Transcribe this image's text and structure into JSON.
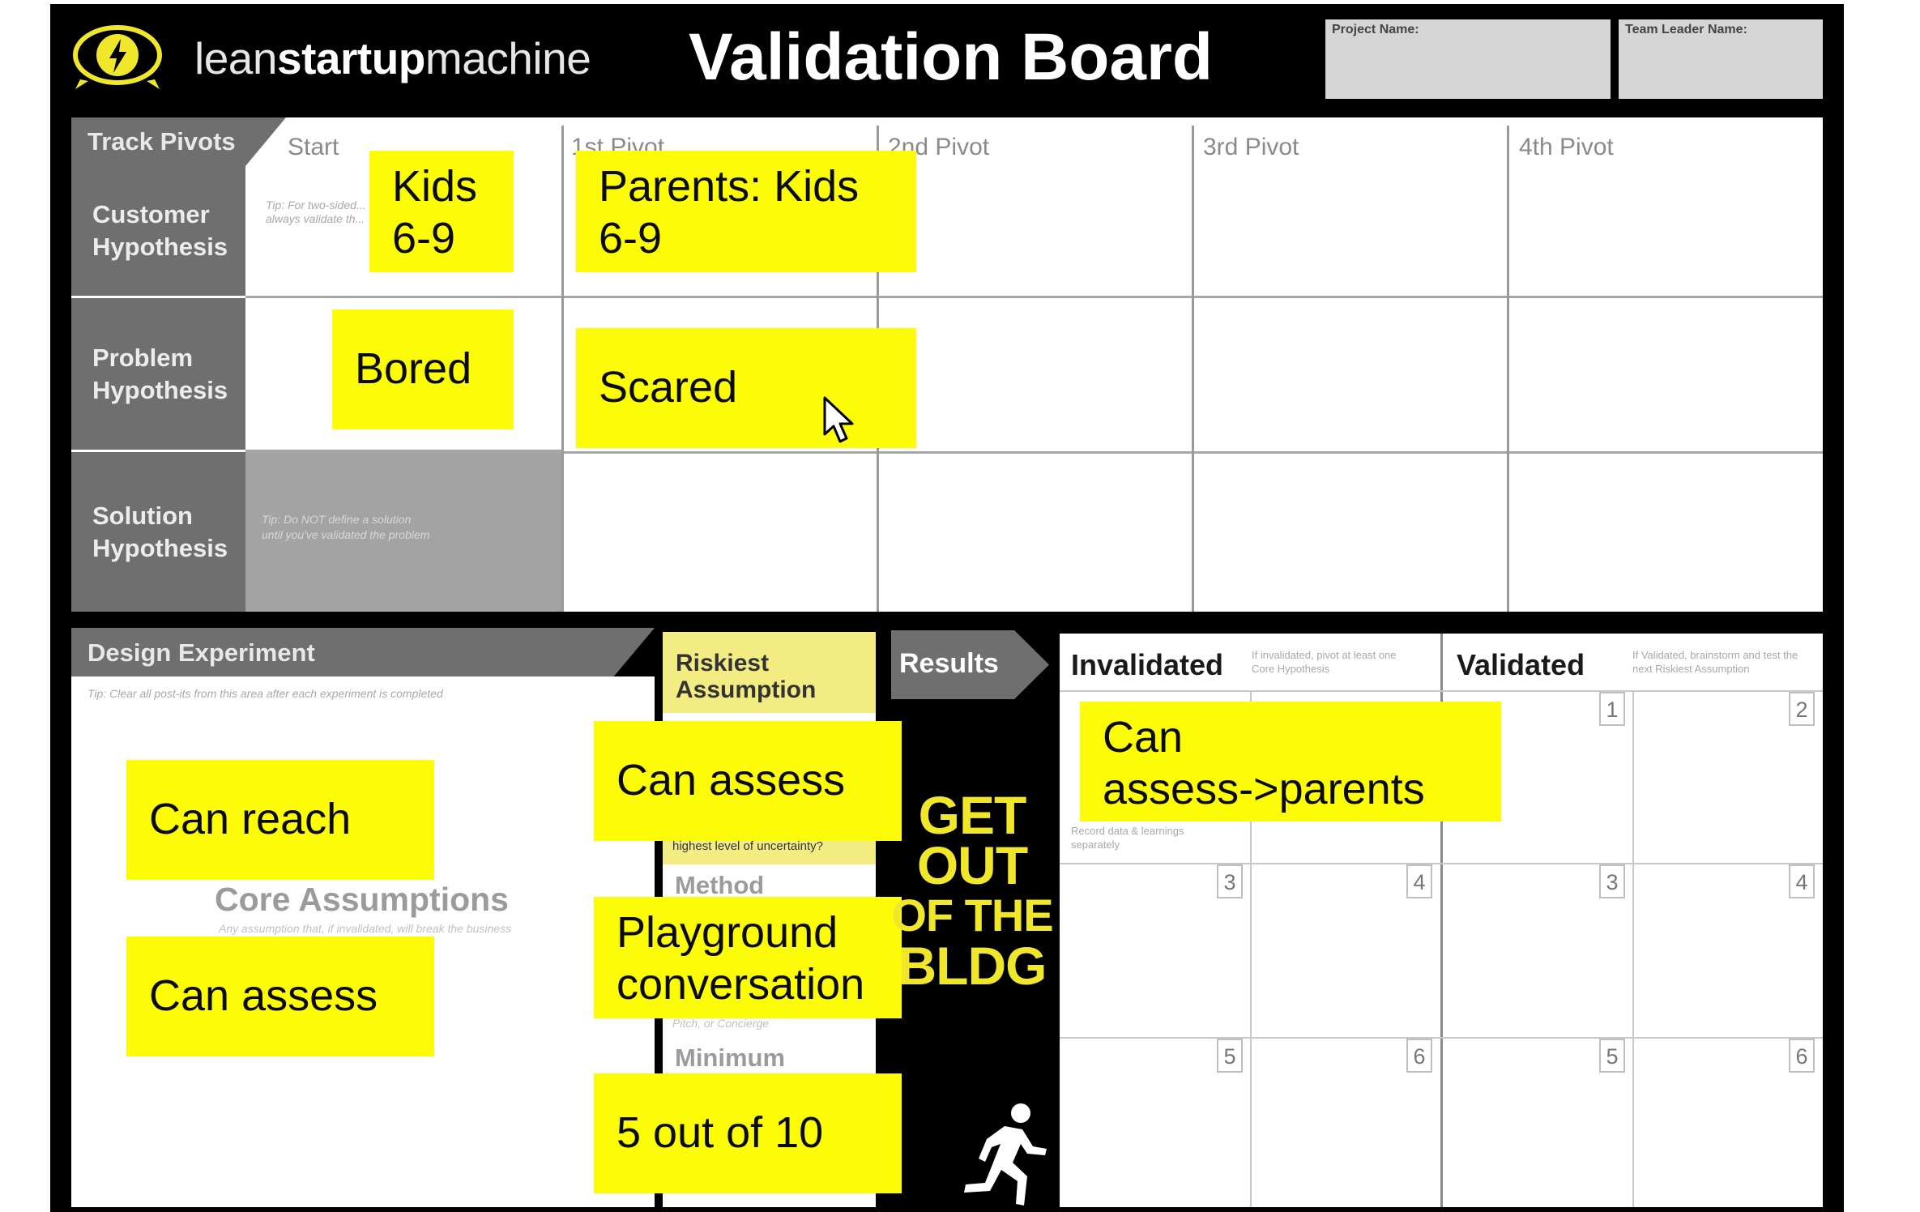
{
  "header": {
    "brand_prefix": "lean",
    "brand_bold": "startup",
    "brand_suffix": "machine",
    "title": "Validation Board",
    "project_name_label": "Project Name:",
    "team_leader_label": "Team Leader Name:"
  },
  "pivots": {
    "track_label": "Track Pivots",
    "columns": [
      "Start",
      "1st Pivot",
      "2nd Pivot",
      "3rd Pivot",
      "4th Pivot"
    ],
    "rows": [
      {
        "l1": "Customer",
        "l2": "Hypothesis"
      },
      {
        "l1": "Problem",
        "l2": "Hypothesis"
      },
      {
        "l1": "Solution",
        "l2": "Hypothesis"
      }
    ],
    "tip_customer": "Tip: For two-sided... always validate th...",
    "tip_solution_1": "Tip: Do NOT define a solution",
    "tip_solution_2": "until you've validated the problem"
  },
  "design": {
    "label": "Design Experiment",
    "tip": "Tip: Clear all post-its from this area after each experiment is completed",
    "core_title": "Core Assumptions",
    "core_sub": "Any assumption that, if invalidated, will break the business"
  },
  "riskiest": {
    "label_1": "Riskiest",
    "label_2": "Assumption",
    "question": "highest level of uncertainty?",
    "method": "Method",
    "method_sub": "Pitch, or Concierge",
    "minimum": "Minimum"
  },
  "results": {
    "label": "Results",
    "getout": [
      "GET",
      "OUT",
      "OF THE",
      "BLDG"
    ],
    "invalidated": "Invalidated",
    "invalidated_tip": "If invalidated, pivot at least one Core Hypothesis",
    "validated": "Validated",
    "validated_tip": "If Validated, brainstorm and test the next Riskiest Assumption",
    "record_tip": "Record data & learnings separately",
    "numbers": [
      "1",
      "2",
      "3",
      "4",
      "5",
      "6"
    ]
  },
  "stickies": {
    "kids": "Kids",
    "kids_age": "6-9",
    "parents": "Parents: Kids",
    "parents_age": "6-9",
    "bored": "Bored",
    "scared": "Scared",
    "can_reach": "Can reach",
    "can_assess_core": "Can assess",
    "can_assess_riskiest": "Can assess",
    "playground_1": "Playground",
    "playground_2": "conversation",
    "five_of_ten": "5 out of 10",
    "result_1": "Can",
    "result_2": "assess->parents"
  },
  "colors": {
    "board": "#000000",
    "sticky": "#fdfc08",
    "header_gray": "#6f6f6f",
    "riskiest_yellow": "#f2ec83",
    "getout_yellow": "#f0e62a"
  }
}
